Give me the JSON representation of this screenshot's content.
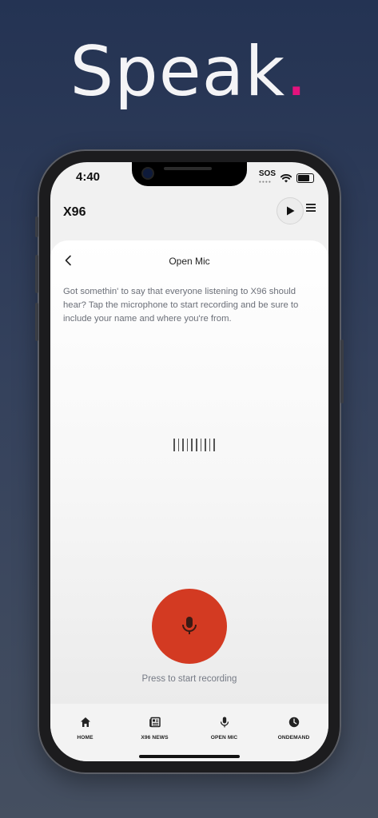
{
  "headline": {
    "text": "Speak",
    "dot": ".",
    "dot_color": "#e4127d"
  },
  "status": {
    "time": "4:40",
    "sos": "SOS"
  },
  "appbar": {
    "logo": "X96",
    "play_icon": "play-icon",
    "menu_icon": "hamburger-menu-icon"
  },
  "sheet": {
    "title": "Open Mic",
    "description": "Got somethin' to say that everyone listening to X96 should hear? Tap the microphone to start recording and be sure to include your name and where you're from.",
    "record_hint": "Press to start recording",
    "record_button_color": "#d33a22"
  },
  "tabs": [
    {
      "label": "HOME",
      "icon": "home-icon"
    },
    {
      "label": "X96 NEWS",
      "icon": "newspaper-icon"
    },
    {
      "label": "OPEN MIC",
      "icon": "microphone-icon"
    },
    {
      "label": "ONDEMAND",
      "icon": "clock-icon"
    }
  ]
}
